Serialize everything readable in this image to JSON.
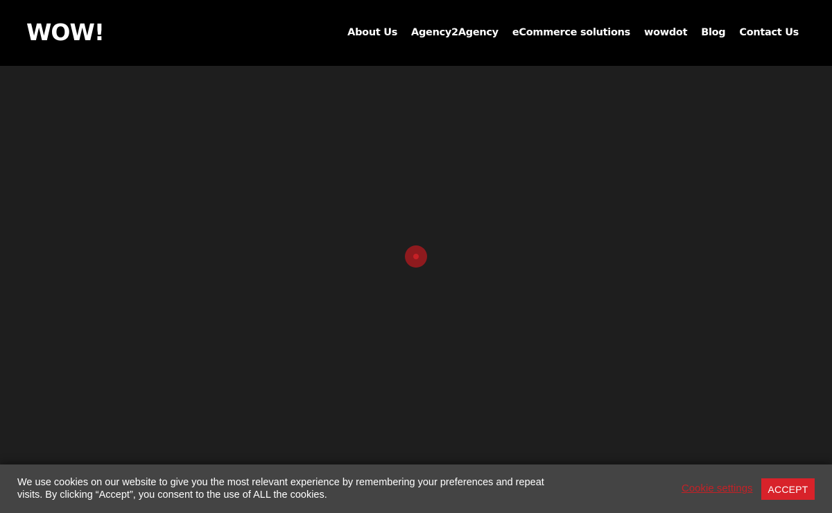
{
  "header": {
    "logo_text": "WOW!",
    "nav": [
      {
        "label": "About Us"
      },
      {
        "label": "Agency2Agency"
      },
      {
        "label": "eCommerce solutions"
      },
      {
        "label": "wowdot"
      },
      {
        "label": "Blog"
      },
      {
        "label": "Contact Us"
      }
    ]
  },
  "loader": {
    "icon": "loading-spinner-icon",
    "color": "#c62026"
  },
  "cookie_banner": {
    "message": "We use cookies on our website to give you the most relevant experience by remembering your preferences and repeat visits. By clicking “Accept”, you consent to the use of ALL the cookies.",
    "settings_label": "Cookie settings",
    "accept_label": "ACCEPT",
    "accent_color": "#d8222a"
  },
  "colors": {
    "header_bg": "#000000",
    "page_bg": "#1e1e1e",
    "banner_bg": "#444444"
  }
}
